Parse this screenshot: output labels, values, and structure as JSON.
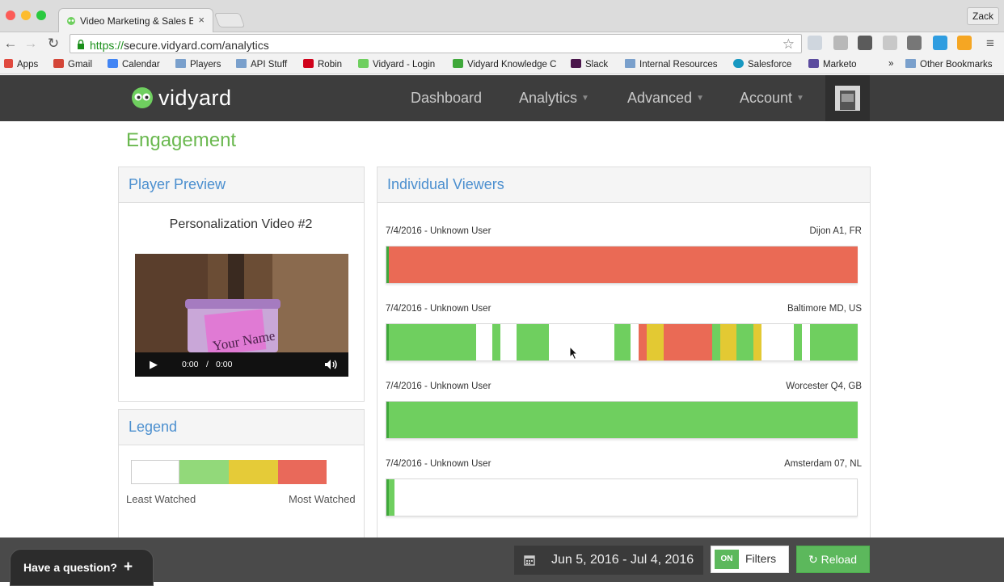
{
  "browser": {
    "profile_name": "Zack",
    "tab_title": "Video Marketing & Sales Er",
    "url_scheme": "https://",
    "url_rest": "secure.vidyard.com/analytics",
    "bookmarks": [
      "Apps",
      "Gmail",
      "Calendar",
      "Players",
      "API Stuff",
      "Robin",
      "Vidyard - Login",
      "Vidyard Knowledge C",
      "Slack",
      "Internal Resources",
      "Salesforce",
      "Marketo"
    ],
    "other_bookmarks": "Other Bookmarks",
    "more_bookmarks": "»"
  },
  "app": {
    "logo_text": "vidyard",
    "nav": [
      {
        "label": "Dashboard"
      },
      {
        "label": "Analytics"
      },
      {
        "label": "Advanced"
      },
      {
        "label": "Account"
      }
    ]
  },
  "page": {
    "title": "Engagement",
    "player_preview": {
      "heading": "Player Preview",
      "video_title": "Personalization Video #2",
      "overlay_text": "Your Name",
      "time_current": "0:00",
      "time_sep": "/",
      "time_total": "0:00"
    },
    "legend": {
      "heading": "Legend",
      "least_label": "Least Watched",
      "most_label": "Most Watched",
      "colors": [
        "#ffffff",
        "#92d97a",
        "#e5cb38",
        "#e9695a"
      ]
    },
    "viewers": {
      "heading": "Individual Viewers",
      "rows": [
        {
          "date_user": "7/4/2016 - Unknown User",
          "location": "Dijon A1, FR"
        },
        {
          "date_user": "7/4/2016 - Unknown User",
          "location": "Baltimore MD, US"
        },
        {
          "date_user": "7/4/2016 - Unknown User",
          "location": "Worcester Q4, GB"
        },
        {
          "date_user": "7/4/2016 - Unknown User",
          "location": "Amsterdam 07, NL"
        }
      ]
    }
  },
  "footer": {
    "question": "Have a question?",
    "question_plus": "+",
    "date_range": "Jun 5, 2016 - Jul 4, 2016",
    "toggle": "ON",
    "filters": "Filters",
    "reload": "Reload"
  },
  "colors": {
    "green": "#6fcf5f",
    "dark_green": "#3fa83a",
    "yellow": "#e3c933",
    "red": "#ea6a55",
    "title_green": "#6ab84f",
    "link_blue": "#4b8fcf"
  }
}
